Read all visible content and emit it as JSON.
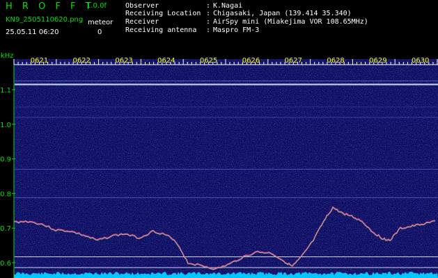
{
  "header": {
    "app_title": "H R O F F T",
    "version": "1.0.0f",
    "filename": "KN9_2505110620.png",
    "timestamp": "25.05.11 06:20",
    "meteor_label": "meteor",
    "meteor_count": "0"
  },
  "station_info": [
    {
      "label": "Observer",
      "value": "K.Nagai"
    },
    {
      "label": "Receiving Location",
      "value": "Chigasaki, Japan (139.414 35.340)"
    },
    {
      "label": "Receiver",
      "value": "AirSpy mini (Miakejima VOR 108.65MHz)"
    },
    {
      "label": "Receiving antenna",
      "value": "Maspro FM-3"
    }
  ],
  "separator": ":",
  "spectrogram": {
    "y_unit": "kHz",
    "y_ticks": [
      "1.1",
      "1.0",
      "0.9",
      "0.8",
      "0.7",
      "0.6"
    ],
    "x_ticks": [
      "0621",
      "0622",
      "0623",
      "0624",
      "0625",
      "0626",
      "0627",
      "0628",
      "0629",
      "0630"
    ],
    "colors": {
      "background": "#0b0b5e",
      "text_green": "#00e000",
      "tick_yellow": "#ffff00",
      "noise_floor": "#00c8ff"
    }
  }
}
